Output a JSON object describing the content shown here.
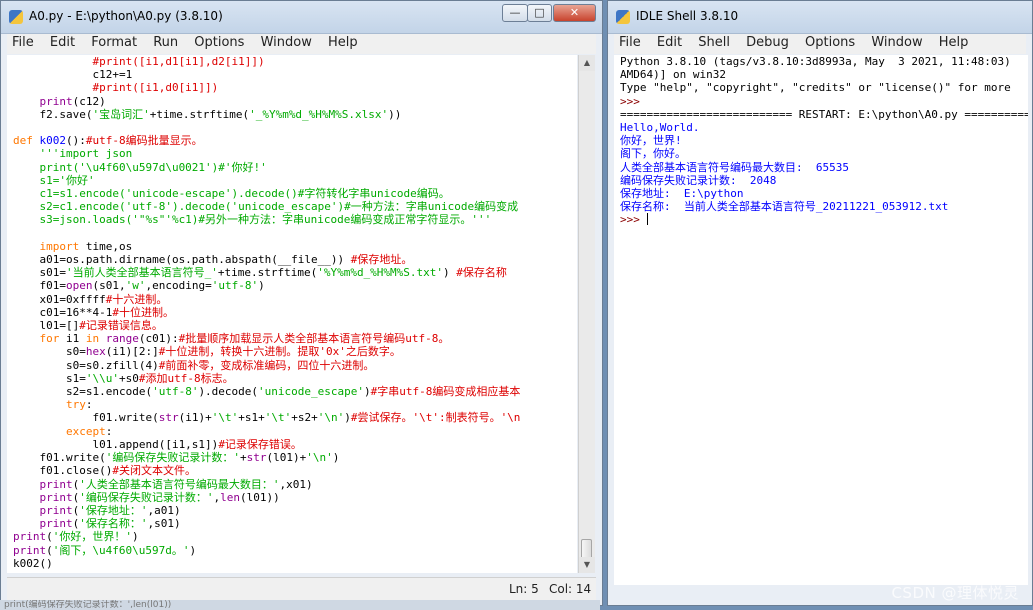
{
  "editor": {
    "title": "A0.py - E:\\python\\A0.py (3.8.10)",
    "window_buttons": {
      "minimize": "—",
      "maximize": "□",
      "close": "✕"
    },
    "menu": [
      "File",
      "Edit",
      "Format",
      "Run",
      "Options",
      "Window",
      "Help"
    ],
    "code_lines": [
      [
        [
          "#print([i1,d1[i1],d2[i1]])",
          "cm",
          12
        ]
      ],
      [
        [
          "c12+=1",
          "",
          12
        ]
      ],
      [
        [
          "#print([i1,d0[i1]])",
          "cm",
          12
        ]
      ],
      [
        [
          "print",
          "bi",
          4
        ],
        [
          "(c12)",
          ""
        ]
      ],
      [
        [
          "f2.save(",
          "",
          4
        ],
        [
          "'宝岛词汇'",
          "st"
        ],
        [
          "+time.strftime(",
          ""
        ],
        [
          "'_%Y%m%d_%H%M%S.xlsx'",
          "st"
        ],
        [
          "))",
          ""
        ]
      ],
      [],
      [
        [
          "def ",
          "kw",
          0
        ],
        [
          "k002",
          "df"
        ],
        [
          "():",
          ""
        ],
        [
          "#utf-8编码批量显示。",
          "cm"
        ]
      ],
      [
        [
          "'''import json",
          "st",
          4
        ]
      ],
      [
        [
          "print('\\u4f60\\u597d\\u0021')#'你好!'",
          "st",
          4
        ]
      ],
      [
        [
          "s1='你好'",
          "st",
          4
        ]
      ],
      [
        [
          "c1=s1.encode('unicode-escape').decode()#字符转化字串unicode编码。",
          "st",
          4
        ]
      ],
      [
        [
          "s2=c1.encode('utf-8').decode('unicode_escape')#一种方法：字串unicode编码变成",
          "st",
          4
        ]
      ],
      [
        [
          "s3=json.loads('\"%s\"'%c1)#另外一种方法：字串unicode编码变成正常字符显示。'''",
          "st",
          4
        ]
      ],
      [],
      [
        [
          "import",
          "kw",
          4
        ],
        [
          " time,os",
          ""
        ]
      ],
      [
        [
          "a01=os.path.dirname(os.path.abspath(__file__)) ",
          "",
          4
        ],
        [
          "#保存地址。",
          "cm"
        ]
      ],
      [
        [
          "s01=",
          "",
          4
        ],
        [
          "'当前人类全部基本语言符号_'",
          "st"
        ],
        [
          "+time.strftime(",
          ""
        ],
        [
          "'%Y%m%d_%H%M%S.txt'",
          "st"
        ],
        [
          ") ",
          ""
        ],
        [
          "#保存名称",
          "cm"
        ]
      ],
      [
        [
          "f01=",
          "",
          4
        ],
        [
          "open",
          "bi"
        ],
        [
          "(s01,",
          ""
        ],
        [
          "'w'",
          "st"
        ],
        [
          ",encoding=",
          ""
        ],
        [
          "'utf-8'",
          "st"
        ],
        [
          ")",
          ""
        ]
      ],
      [
        [
          "x01=0xffff",
          "",
          4
        ],
        [
          "#十六进制。",
          "cm"
        ]
      ],
      [
        [
          "c01=16**4-1",
          "",
          4
        ],
        [
          "#十位进制。",
          "cm"
        ]
      ],
      [
        [
          "l01=[]",
          "",
          4
        ],
        [
          "#记录错误信息。",
          "cm"
        ]
      ],
      [
        [
          "for",
          "kw",
          4
        ],
        [
          " i1 ",
          ""
        ],
        [
          "in",
          "kw"
        ],
        [
          " ",
          ""
        ],
        [
          "range",
          "bi"
        ],
        [
          "(c01):",
          ""
        ],
        [
          "#批量顺序加载显示人类全部基本语言符号编码utf-8。",
          "cm"
        ]
      ],
      [
        [
          "s0=",
          "",
          8
        ],
        [
          "hex",
          "bi"
        ],
        [
          "(i1)[2:]",
          ""
        ],
        [
          "#十位进制，转换十六进制。提取'0x'之后数字。",
          "cm"
        ]
      ],
      [
        [
          "s0=s0.zfill(4)",
          "",
          8
        ],
        [
          "#前面补零，变成标准编码，四位十六进制。",
          "cm"
        ]
      ],
      [
        [
          "s1=",
          "",
          8
        ],
        [
          "'\\\\u'",
          "st"
        ],
        [
          "+s0",
          ""
        ],
        [
          "#添加utf-8标志。",
          "cm"
        ]
      ],
      [
        [
          "s2=s1.encode(",
          "",
          8
        ],
        [
          "'utf-8'",
          "st"
        ],
        [
          ").decode(",
          ""
        ],
        [
          "'unicode_escape'",
          "st"
        ],
        [
          ")",
          ""
        ],
        [
          "#字串utf-8编码变成相应基本",
          "cm"
        ]
      ],
      [
        [
          "try",
          "kw",
          8
        ],
        [
          ":",
          ""
        ]
      ],
      [
        [
          "f01.write(",
          "",
          12
        ],
        [
          "str",
          "bi"
        ],
        [
          "(i1)+",
          ""
        ],
        [
          "'\\t'",
          "st"
        ],
        [
          "+s1+",
          ""
        ],
        [
          "'\\t'",
          "st"
        ],
        [
          "+s2+",
          ""
        ],
        [
          "'\\n'",
          "st"
        ],
        [
          ")",
          ""
        ],
        [
          "#尝试保存。'\\t':制表符号。'\\n",
          "cm"
        ]
      ],
      [
        [
          "except",
          "kw",
          8
        ],
        [
          ":",
          ""
        ]
      ],
      [
        [
          "l01.append([i1,s1])",
          "",
          12
        ],
        [
          "#记录保存错误。",
          "cm"
        ]
      ],
      [
        [
          "f01.write(",
          "",
          4
        ],
        [
          "'编码保存失败记录计数：'",
          "st"
        ],
        [
          "+",
          ""
        ],
        [
          "str",
          "bi"
        ],
        [
          "(l01)+",
          ""
        ],
        [
          "'\\n'",
          "st"
        ],
        [
          ")",
          ""
        ]
      ],
      [
        [
          "f01.close()",
          "",
          4
        ],
        [
          "#关闭文本文件。",
          "cm"
        ]
      ],
      [
        [
          "print",
          "bi",
          4
        ],
        [
          "(",
          ""
        ],
        [
          "'人类全部基本语言符号编码最大数目：'",
          "st"
        ],
        [
          ",x01)",
          ""
        ]
      ],
      [
        [
          "print",
          "bi",
          4
        ],
        [
          "(",
          ""
        ],
        [
          "'编码保存失败记录计数：'",
          "st"
        ],
        [
          ",",
          ""
        ],
        [
          "len",
          "bi"
        ],
        [
          "(l01))",
          ""
        ]
      ],
      [
        [
          "print",
          "bi",
          4
        ],
        [
          "(",
          ""
        ],
        [
          "'保存地址：'",
          "st"
        ],
        [
          ",a01)",
          ""
        ]
      ],
      [
        [
          "print",
          "bi",
          4
        ],
        [
          "(",
          ""
        ],
        [
          "'保存名称：'",
          "st"
        ],
        [
          ",s01)",
          ""
        ]
      ],
      [
        [
          "print",
          "bi",
          0
        ],
        [
          "(",
          ""
        ],
        [
          "'你好，世界！'",
          "st"
        ],
        [
          ")",
          ""
        ]
      ],
      [
        [
          "print",
          "bi",
          0
        ],
        [
          "(",
          ""
        ],
        [
          "'阁下，\\u4f60\\u597d。'",
          "st"
        ],
        [
          ")",
          ""
        ]
      ],
      [
        [
          "k002()",
          "",
          0
        ]
      ]
    ],
    "status": {
      "line": "Ln: 5",
      "col": "Col: 14"
    }
  },
  "shell": {
    "title": "IDLE Shell 3.8.10",
    "menu": [
      "File",
      "Edit",
      "Shell",
      "Debug",
      "Options",
      "Window",
      "Help"
    ],
    "lines": [
      [
        "Python 3.8.10 (tags/v3.8.10:3d8993a, May  3 2021, 11:48:03)",
        ""
      ],
      [
        "AMD64)] on win32",
        ""
      ],
      [
        "Type \"help\", \"copyright\", \"credits\" or \"license()\" for more",
        ""
      ],
      [
        ">>> ",
        "prompt"
      ],
      [
        "========================== RESTART: E:\\python\\A0.py ==========",
        ""
      ],
      [
        "Hello,World.",
        "out"
      ],
      [
        "你好，世界!",
        "out"
      ],
      [
        "阁下，你好。",
        "out"
      ],
      [
        "人类全部基本语言符号编码最大数目:  65535",
        "out"
      ],
      [
        "编码保存失败记录计数:  2048",
        "out"
      ],
      [
        "保存地址:  E:\\python",
        "out"
      ],
      [
        "保存名称:  当前人类全部基本语言符号_20211221_053912.txt",
        "out"
      ],
      [
        ">>> ",
        "prompt"
      ]
    ]
  },
  "watermark": "CSDN @理体悦灵",
  "bottom_strip": "print(编码保存失败记录计数：',len(l01))"
}
